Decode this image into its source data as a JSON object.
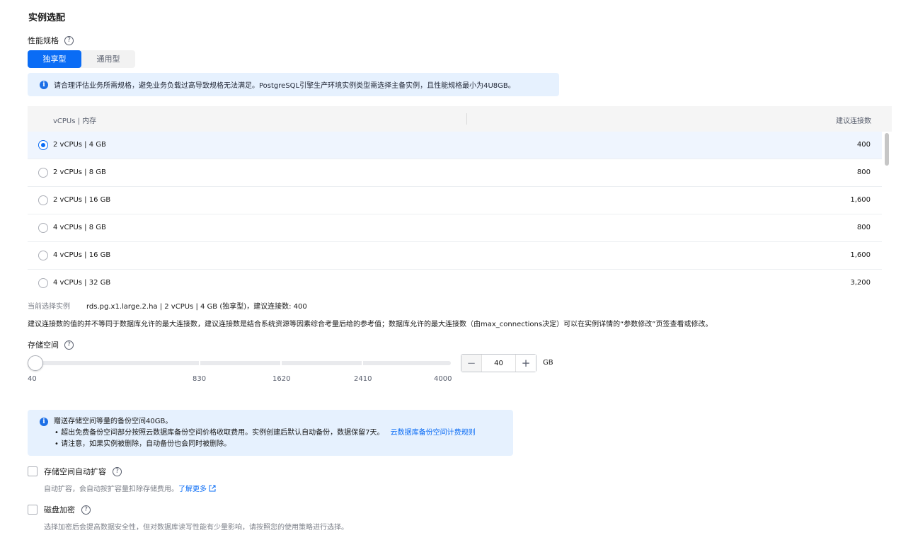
{
  "section_title": "实例选配",
  "spec": {
    "label": "性能规格",
    "tabs": [
      {
        "label": "独享型",
        "active": true
      },
      {
        "label": "通用型",
        "active": false
      }
    ],
    "notice": "请合理评估业务所需规格，避免业务负载过高导致规格无法满足。PostgreSQL引擎生产环境实例类型需选择主备实例，且性能规格最小为4U8GB。"
  },
  "table": {
    "col_spec": "vCPUs | 内存",
    "col_conn": "建议连接数",
    "rows": [
      {
        "spec": "2 vCPUs | 4 GB",
        "conn": "400",
        "selected": true
      },
      {
        "spec": "2 vCPUs | 8 GB",
        "conn": "800",
        "selected": false
      },
      {
        "spec": "2 vCPUs | 16 GB",
        "conn": "1,600",
        "selected": false
      },
      {
        "spec": "4 vCPUs | 8 GB",
        "conn": "800",
        "selected": false
      },
      {
        "spec": "4 vCPUs | 16 GB",
        "conn": "1,600",
        "selected": false
      },
      {
        "spec": "4 vCPUs | 32 GB",
        "conn": "3,200",
        "selected": false
      }
    ]
  },
  "current": {
    "label": "当前选择实例",
    "value": "rds.pg.x1.large.2.ha | 2 vCPUs | 4 GB (独享型)，建议连接数: 400"
  },
  "conn_desc": "建议连接数的值的并不等同于数据库允许的最大连接数，建议连接数是结合系统资源等因素综合考量后给的参考值；数据库允许的最大连接数（由max_connections决定）可以在实例详情的“参数修改”页签查看或修改。",
  "storage": {
    "label": "存储空间",
    "ticks": [
      "40",
      "830",
      "1620",
      "2410",
      "4000"
    ],
    "value": "40",
    "unit": "GB",
    "minus": "−",
    "plus": "+"
  },
  "backup_notice": {
    "title": "赠送存储空间等量的备份空间40GB。",
    "bullet1": "• 超出免费备份空间部分按照云数据库备份空间价格收取费用。实例创建后默认自动备份，数据保留7天。",
    "bullet1_link": "云数据库备份空间计费规则",
    "bullet2": "• 请注意，如果实例被删除，自动备份也会同时被删除。"
  },
  "auto_expand": {
    "label": "存储空间自动扩容",
    "desc": "自动扩容，会自动按扩容量扣除存储费用。",
    "link": "了解更多"
  },
  "encrypt": {
    "label": "磁盘加密",
    "desc": "选择加密后会提高数据安全性，但对数据库读写性能有少量影响，请按照您的使用策略进行选择。"
  },
  "colors": {
    "primary": "#0a6cf5",
    "notice_bg": "#e6f1fe",
    "selected_row_bg": "#eff5fe"
  },
  "icons": {
    "help": "question-circle-icon",
    "info": "info-circle-icon",
    "external": "external-link-icon"
  }
}
